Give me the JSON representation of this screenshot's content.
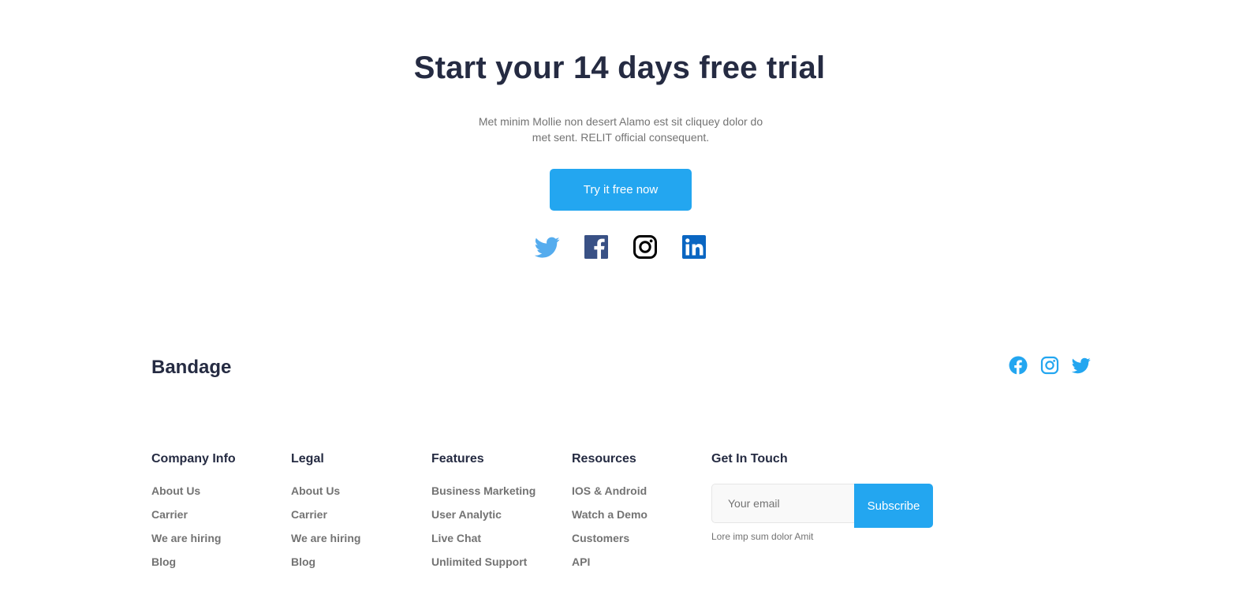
{
  "cta": {
    "title": "Start your 14 days free trial",
    "description": "Met minim Mollie non desert Alamo est sit cliquey dolor do met sent. RELIT official consequent.",
    "button_label": "Try it free now",
    "social_icons": [
      "twitter-icon",
      "facebook-icon",
      "instagram-icon",
      "linkedin-icon"
    ]
  },
  "footer": {
    "brand": "Bandage",
    "social_icons": [
      "facebook-icon",
      "instagram-icon",
      "twitter-icon"
    ],
    "columns": [
      {
        "title": "Company Info",
        "links": [
          "About Us",
          "Carrier",
          "We are hiring",
          "Blog"
        ]
      },
      {
        "title": "Legal",
        "links": [
          "About Us",
          "Carrier",
          "We are hiring",
          "Blog"
        ]
      },
      {
        "title": "Features",
        "links": [
          "Business Marketing",
          "User Analytic",
          "Live Chat",
          "Unlimited Support"
        ]
      },
      {
        "title": "Resources",
        "links": [
          "IOS & Android",
          "Watch a Demo",
          "Customers",
          "API"
        ]
      }
    ],
    "contact": {
      "title": "Get In Touch",
      "email_placeholder": "Your email",
      "email_value": "",
      "subscribe_label": "Subscribe",
      "note": "Lore imp sum dolor Amit"
    }
  },
  "colors": {
    "primary": "#23a6f0",
    "heading": "#252b42",
    "text": "#737373",
    "twitter": "#55acee",
    "facebook": "#395185",
    "instagram": "#000000",
    "linkedin": "#0a66c2"
  }
}
